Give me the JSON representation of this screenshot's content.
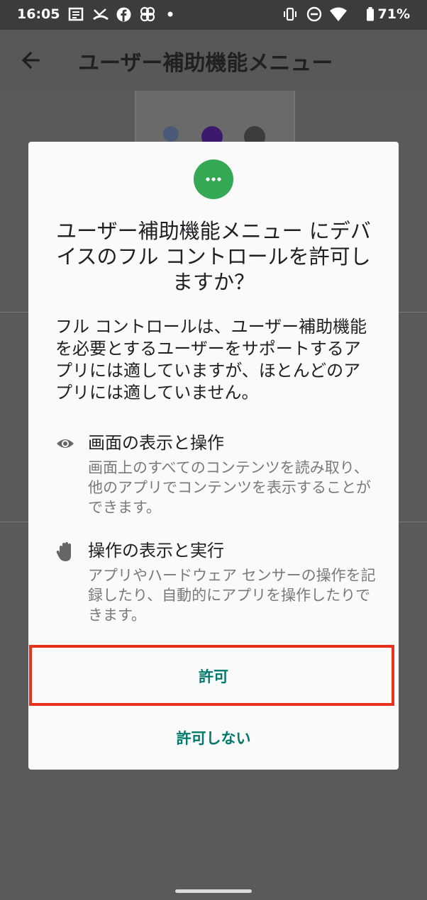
{
  "status_bar": {
    "time": "16:05",
    "battery": "71%"
  },
  "app_bar": {
    "title": "ユーザー補助機能メニュー"
  },
  "dialog": {
    "title": "ユーザー補助機能メニュー にデバイスのフル コントロールを許可しますか？",
    "body": "フル コントロールは、ユーザー補助機能を必要とするユーザーをサポートするアプリには適していますが、ほとんどのアプリには適していません。",
    "permissions": [
      {
        "title": "画面の表示と操作",
        "description": "画面上のすべてのコンテンツを読み取り、他のアプリでコンテンツを表示することができます。",
        "icon": "eye-icon"
      },
      {
        "title": "操作の表示と実行",
        "description": "アプリやハードウェア センサーの操作を記録したり、自動的にアプリを操作したりできます。",
        "icon": "hand-icon"
      }
    ],
    "allow_label": "許可",
    "deny_label": "許可しない"
  },
  "colors": {
    "accent": "#00796b",
    "icon_bg": "#34a853",
    "highlight": "#e8321e"
  }
}
